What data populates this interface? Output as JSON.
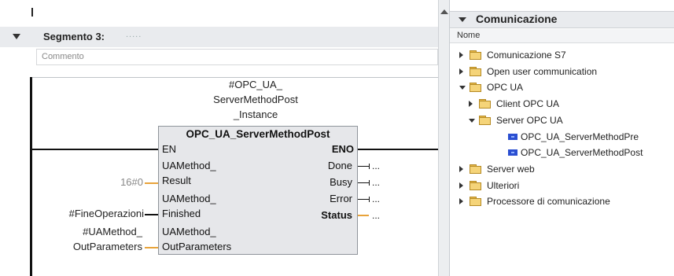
{
  "editor": {
    "segment_title": "Segmento 3:",
    "segment_dots": ".....",
    "comment_placeholder": "Commento",
    "instance_line1": "#OPC_UA_",
    "instance_line2": "ServerMethodPost",
    "instance_line3": "_Instance",
    "block": {
      "title": "OPC_UA_ServerMethodPost",
      "in_en": "EN",
      "in_result_1": "UAMethod_",
      "in_result_2": "Result",
      "in_finished_1": "UAMethod_",
      "in_finished_2": "Finished",
      "in_outparams_1": "UAMethod_",
      "in_outparams_2": "OutParameters",
      "out_eno": "ENO",
      "out_done": "Done",
      "out_busy": "Busy",
      "out_error": "Error",
      "out_status": "Status"
    },
    "actual_result": "16#0",
    "actual_finished": "#FineOperazioni",
    "actual_outparams_1": "#UAMethod_",
    "actual_outparams_2": "OutParameters",
    "ellipsis": "..."
  },
  "panel": {
    "title": "Comunicazione",
    "column_header": "Nome",
    "tree": [
      {
        "label": "Comunicazione S7",
        "level": 0,
        "expanded": false,
        "kind": "folder"
      },
      {
        "label": "Open user communication",
        "level": 0,
        "expanded": false,
        "kind": "folder"
      },
      {
        "label": "OPC UA",
        "level": 0,
        "expanded": true,
        "kind": "folder"
      },
      {
        "label": "Client OPC UA",
        "level": 1,
        "expanded": false,
        "kind": "folder"
      },
      {
        "label": "Server OPC UA",
        "level": 1,
        "expanded": true,
        "kind": "folder"
      },
      {
        "label": "OPC_UA_ServerMethodPre",
        "level": 2,
        "kind": "function-block"
      },
      {
        "label": "OPC_UA_ServerMethodPost",
        "level": 2,
        "kind": "function-block"
      },
      {
        "label": "Server web",
        "level": 0,
        "expanded": false,
        "kind": "folder"
      },
      {
        "label": "Ulteriori",
        "level": 0,
        "expanded": false,
        "kind": "folder"
      },
      {
        "label": "Processore di comunicazione",
        "level": 0,
        "expanded": false,
        "kind": "folder"
      }
    ]
  },
  "colors": {
    "segment_bg": "#e9ebee",
    "block_bg": "#e6e7ea",
    "param_wire": "#e8a33a",
    "fb_icon": "#2b4fd1",
    "folder": "#f5d479"
  }
}
